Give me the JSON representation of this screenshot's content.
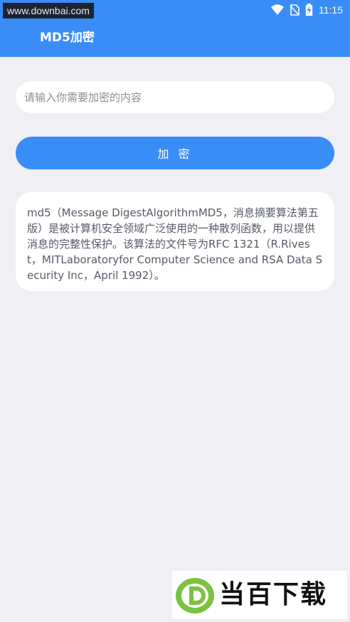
{
  "status_bar": {
    "watermark": "www.downbai.com",
    "time": "11:15"
  },
  "app": {
    "title": "MD5加密"
  },
  "form": {
    "input_placeholder": "请输入你需要加密的内容",
    "input_value": "",
    "encrypt_button": "加 密"
  },
  "result": {
    "text": "md5（Message DigestAlgorithmMD5，消息摘要算法第五版）是被计算机安全领域广泛使用的一种散列函数，用以提供消息的完整性保护。该算法的文件号为RFC 1321（R.Rivest，MITLaboratoryfor Computer Science and RSA Data Security Inc，April 1992）。"
  },
  "watermark_logo": {
    "text": "当百下载",
    "colors": {
      "green": "#7cc242",
      "accent": "#3a8cf6"
    }
  }
}
